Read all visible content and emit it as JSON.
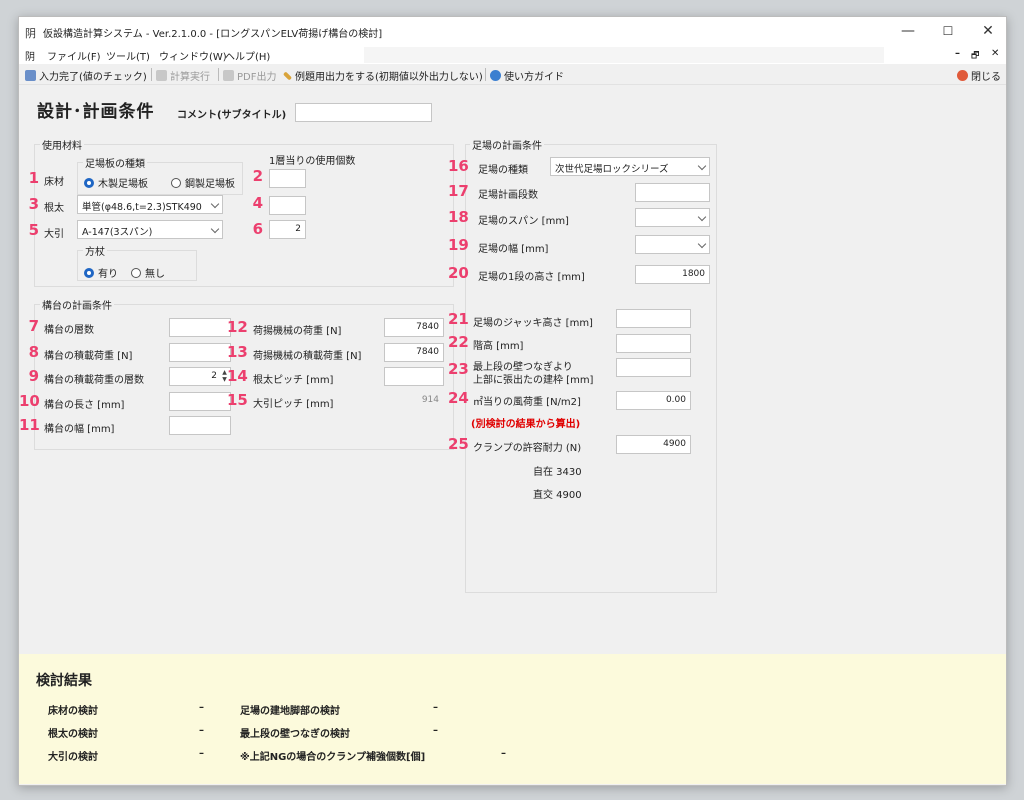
{
  "window": {
    "app_icon": "阴",
    "title": "仮設構造計算システム - Ver.2.1.0.0 - [ロングスパンELV荷揚げ構台の検討]",
    "minimize": "—",
    "maximize": "☐",
    "close": "✕",
    "mdi_min": "–",
    "mdi_restore": "🗗",
    "mdi_close": "✕"
  },
  "menu": [
    "ファイル(F)",
    "ツール(T)",
    "ウィンドウ(W)",
    "ヘルプ(H)"
  ],
  "toolbar": {
    "check": "入力完了(値のチェック)",
    "calc": "計算実行",
    "pdf": "PDF出力",
    "example": "例題用出力をする(初期値以外出力しない)",
    "guide": "使い方ガイド",
    "close": "閉じる"
  },
  "header": {
    "title": "設計･計画条件",
    "comment_label": "コメント(サブタイトル)",
    "comment_value": ""
  },
  "materials": {
    "group_title": "使用材料",
    "board_group": "足場板の種類",
    "count_header": "1層当りの使用個数",
    "floor": {
      "num": "1",
      "label": "床材",
      "opt_wood": "木製足場板",
      "opt_steel": "鋼製足場板",
      "selected": "wood"
    },
    "count_floor": {
      "num": "2",
      "value": ""
    },
    "joist": {
      "num": "3",
      "label": "根太",
      "value": "単管(φ48.6,t=2.3)STK490"
    },
    "count_joist": {
      "num": "4",
      "value": ""
    },
    "beam": {
      "num": "5",
      "label": "大引",
      "value": "A-147(3スパン)"
    },
    "count_beam": {
      "num": "6",
      "value": "2"
    },
    "brace_group": "方杖",
    "brace_yes": "有り",
    "brace_no": "無し",
    "brace_selected": "yes"
  },
  "platform": {
    "group_title": "構台の計画条件",
    "fields": [
      {
        "num": "7",
        "label": "構台の層数",
        "value": ""
      },
      {
        "num": "8",
        "label": "構台の積載荷重 [N]",
        "value": ""
      },
      {
        "num": "9",
        "label": "構台の積載荷重の層数",
        "value": "2"
      },
      {
        "num": "10",
        "label": "構台の長さ [mm]",
        "value": ""
      },
      {
        "num": "11",
        "label": "構台の幅 [mm]",
        "value": ""
      }
    ],
    "fields2": [
      {
        "num": "12",
        "label": "荷揚機械の荷重 [N]",
        "value": "7840"
      },
      {
        "num": "13",
        "label": "荷揚機械の積載荷重 [N]",
        "value": "7840"
      },
      {
        "num": "14",
        "label": "根太ピッチ [mm]",
        "value": ""
      },
      {
        "num": "15",
        "label": "大引ピッチ [mm]",
        "value": "914"
      }
    ]
  },
  "scaffold": {
    "group_title": "足場の計画条件",
    "type": {
      "num": "16",
      "label": "足場の種類",
      "value": "次世代足場ロックシリーズ"
    },
    "levels": {
      "num": "17",
      "label": "足場計画段数",
      "value": ""
    },
    "span": {
      "num": "18",
      "label": "足場のスパン [mm]",
      "value": ""
    },
    "width": {
      "num": "19",
      "label": "足場の幅 [mm]",
      "value": ""
    },
    "height1": {
      "num": "20",
      "label": "足場の1段の高さ [mm]",
      "value": "1800"
    },
    "jack": {
      "num": "21",
      "label": "足場のジャッキ高さ [mm]",
      "value": ""
    },
    "floor_h": {
      "num": "22",
      "label": "階高 [mm]",
      "value": ""
    },
    "overhang": {
      "num": "23",
      "label1": "最上段の壁つなぎより",
      "label2": "上部に張出たの建枠 [mm]",
      "value": ""
    },
    "wind": {
      "num": "24",
      "label": "㎡当りの風荷重 [N/m2]",
      "value": "0.00"
    },
    "wind_note": "(別検討の結果から算出)",
    "clamp": {
      "num": "25",
      "label": "クランプの許容耐力 (N)",
      "value": "4900"
    },
    "clamp_free": "自在 3430",
    "clamp_right": "直交 4900"
  },
  "results": {
    "title": "検討結果",
    "items": [
      {
        "label": "床材の検討",
        "value": "–"
      },
      {
        "label": "根太の検討",
        "value": "–"
      },
      {
        "label": "大引の検討",
        "value": "–"
      },
      {
        "label": "足場の建地脚部の検討",
        "value": "–"
      },
      {
        "label": "最上段の壁つなぎの検討",
        "value": "–"
      },
      {
        "label": "※上記NGの場合のクランプ補強個数[個]",
        "value": "–"
      }
    ]
  },
  "colors": {
    "accent_number": "#ec3f6e",
    "note_red": "#e00000",
    "result_bg": "#fcfadc",
    "radio_on": "#1f66c4"
  }
}
